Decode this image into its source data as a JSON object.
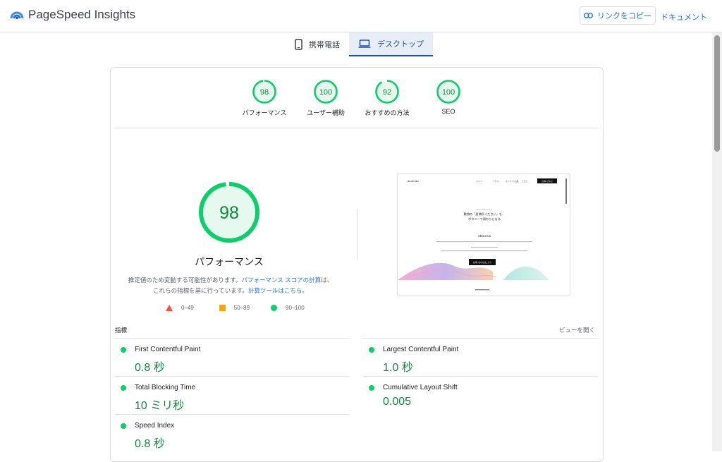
{
  "app": {
    "title": "PageSpeed Insights",
    "copy_link_label": "リンクをコピー",
    "docs_label": "ドキュメント"
  },
  "tabs": [
    {
      "label": "携帯電話",
      "icon": "smartphone-icon",
      "active": false
    },
    {
      "label": "デスクトップ",
      "icon": "laptop-icon",
      "active": true
    }
  ],
  "categories": [
    {
      "score": 98,
      "label": "パフォーマンス"
    },
    {
      "score": 100,
      "label": "ユーザー補助"
    },
    {
      "score": 92,
      "label": "おすすめの方法"
    },
    {
      "score": 100,
      "label": "SEO"
    }
  ],
  "performance": {
    "score": 98,
    "title": "パフォーマンス",
    "desc_part1": "推定値のため変動する可能性があります。",
    "desc_link1": "パフォーマンス スコアの計算",
    "desc_part2": "は、これらの指標を基に行っています。",
    "desc_link2": "計算ツールはこちら。"
  },
  "legend": [
    {
      "range": "0–49",
      "shape": "triangle",
      "color": "#ff4e42"
    },
    {
      "range": "50–89",
      "shape": "square",
      "color": "#ffa400"
    },
    {
      "range": "90–100",
      "shape": "circle",
      "color": "#0cce6b"
    }
  ],
  "metrics_section": {
    "label": "指標",
    "view_toggle": "ビューを開く"
  },
  "metrics": [
    {
      "name": "First Contentful Paint",
      "value": "0.8 秒"
    },
    {
      "name": "Largest Contentful Paint",
      "value": "1.0 秒"
    },
    {
      "name": "Total Blocking Time",
      "value": "10 ミリ秒"
    },
    {
      "name": "Cumulative Layout Shift",
      "value": "0.005"
    },
    {
      "name": "Speed Index",
      "value": "0.8 秒"
    }
  ],
  "screenshot": {
    "brand": "arum lab",
    "nav_items": [
      "Tシャツ",
      "デザイン",
      "オンライン店舗",
      "ブログ"
    ],
    "cta": "お問い合わせ",
    "heading_small": "オリジナルTシャツ",
    "heading_line1": "敷物の「居場所ください」を、",
    "heading_line2": "ボタニーで頑わりになる",
    "about": "About us",
    "button": "お問い合わせはこちら"
  },
  "colors": {
    "pass": "#0cce6b",
    "pass_text": "#0d8a3c",
    "pass_bg": "#e6f9ee",
    "accent": "#1a73e8"
  }
}
